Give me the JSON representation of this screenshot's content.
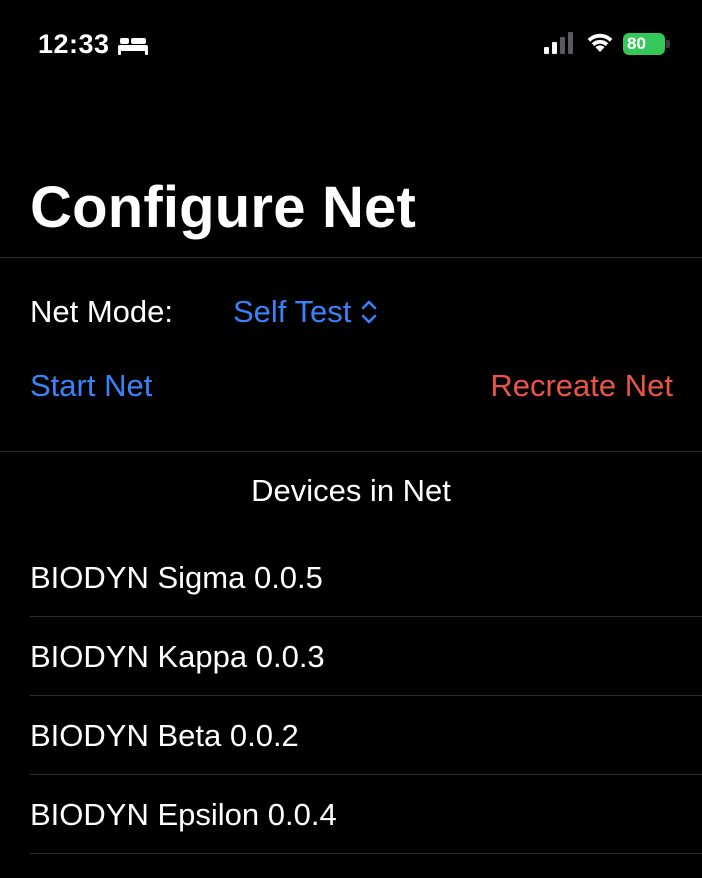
{
  "status_bar": {
    "time": "12:33",
    "battery_level": "80"
  },
  "title": "Configure Net",
  "net_mode": {
    "label": "Net Mode:",
    "value": "Self Test"
  },
  "actions": {
    "start_net": "Start Net",
    "recreate_net": "Recreate Net"
  },
  "devices": {
    "header": "Devices in Net",
    "items": [
      {
        "label": "BIODYN Sigma 0.0.5"
      },
      {
        "label": "BIODYN Kappa 0.0.3"
      },
      {
        "label": "BIODYN Beta 0.0.2"
      },
      {
        "label": "BIODYN Epsilon 0.0.4"
      }
    ]
  },
  "colors": {
    "background": "#000000",
    "accent_blue": "#3a82f7",
    "destructive_red": "#eb5545",
    "battery_green": "#34c759",
    "separator": "#2c2c2e"
  },
  "icons": [
    "bed-icon",
    "cellular-signal-icon",
    "wifi-icon",
    "battery-icon",
    "chevron-up-down-icon"
  ]
}
